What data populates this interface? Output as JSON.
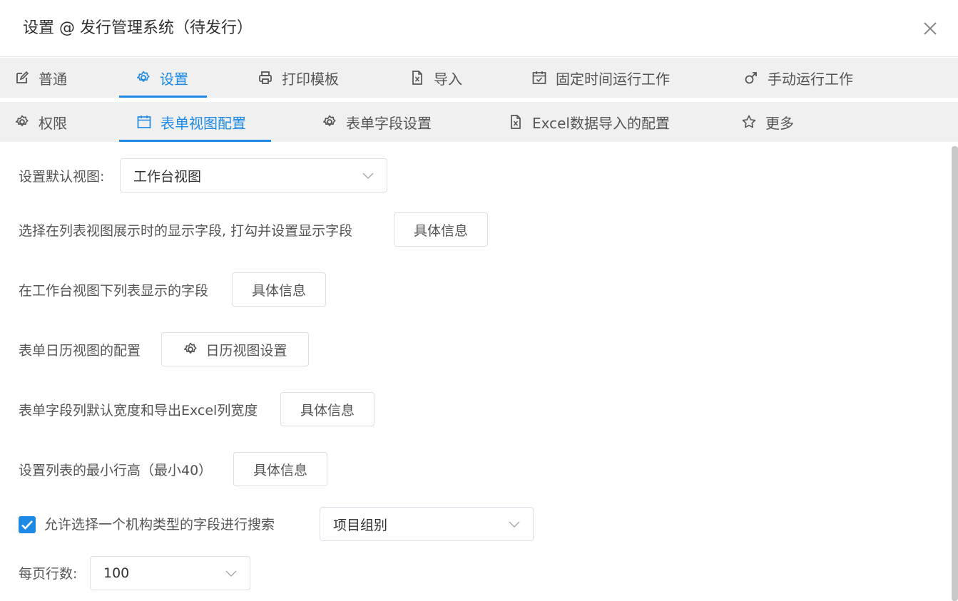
{
  "window": {
    "title": "设置 @ 发行管理系统（待发行）"
  },
  "tabs_row1": [
    {
      "label": "普通",
      "icon": "edit-icon",
      "active": false
    },
    {
      "label": "设置",
      "icon": "gear-icon",
      "active": true
    },
    {
      "label": "打印模板",
      "icon": "printer-icon",
      "active": false
    },
    {
      "label": "导入",
      "icon": "excel-file-icon",
      "active": false
    },
    {
      "label": "固定时间运行工作",
      "icon": "calendar-check-icon",
      "active": false
    },
    {
      "label": "手动运行工作",
      "icon": "male-symbol-icon",
      "active": false
    }
  ],
  "tabs_row2": [
    {
      "label": "权限",
      "icon": "gear-icon",
      "active": false
    },
    {
      "label": "表单视图配置",
      "icon": "calendar-icon",
      "active": true
    },
    {
      "label": "表单字段设置",
      "icon": "gear-icon",
      "active": false
    },
    {
      "label": "Excel数据导入的配置",
      "icon": "excel-file-icon",
      "active": false
    },
    {
      "label": "更多",
      "icon": "star-icon",
      "active": false
    }
  ],
  "form": {
    "default_view": {
      "label": "设置默认视图:",
      "value": "工作台视图"
    },
    "list_display_fields": {
      "label": "选择在列表视图展示时的显示字段, 打勾并设置显示字段",
      "button": "具体信息"
    },
    "workbench_list_fields": {
      "label": "在工作台视图下列表显示的字段",
      "button": "具体信息"
    },
    "calendar_view": {
      "label": "表单日历视图的配置",
      "button": "日历视图设置"
    },
    "column_width": {
      "label": "表单字段列默认宽度和导出Excel列宽度",
      "button": "具体信息"
    },
    "min_row_height": {
      "label": "设置列表的最小行高（最小40）",
      "button": "具体信息"
    },
    "org_search": {
      "checked": true,
      "label": "允许选择一个机构类型的字段进行搜索",
      "value": "项目组别"
    },
    "page_size": {
      "label": "每页行数:",
      "value": "100"
    }
  },
  "colors": {
    "accent": "#1e8ae6",
    "tab_bg": "#f0f0f0",
    "border": "#dcdfe6",
    "text": "#555555"
  }
}
